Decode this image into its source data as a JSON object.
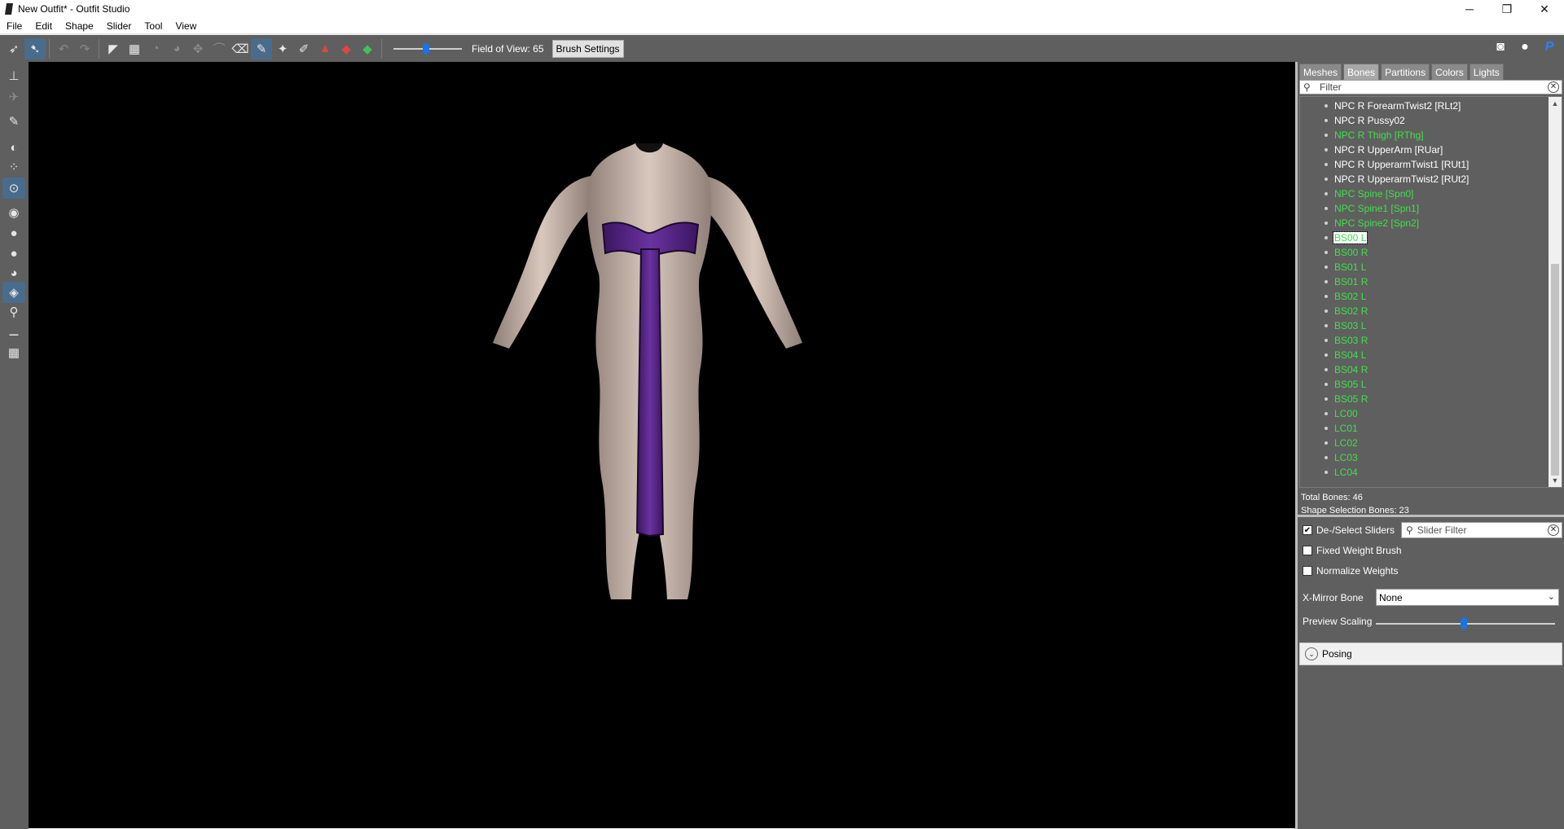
{
  "window": {
    "title": "New Outfit* - Outfit Studio"
  },
  "window_controls": {
    "minimize": "─",
    "maximize": "❐",
    "close": "✕"
  },
  "menu": [
    "File",
    "Edit",
    "Shape",
    "Slider",
    "Tool",
    "View"
  ],
  "toolbar": {
    "field_of_view_label": "Field of View: 65",
    "field_of_view_value": 65,
    "brush_settings_label": "Brush Settings",
    "right_icons": [
      "discord-icon",
      "github-icon",
      "paypal-icon"
    ]
  },
  "right_panel": {
    "tabs": [
      "Meshes",
      "Bones",
      "Partitions",
      "Colors",
      "Lights"
    ],
    "selected_tab": "Bones",
    "filter_placeholder": "Filter",
    "bones": [
      {
        "name": "NPC R ForearmTwist2 [RLt2]",
        "color": "white"
      },
      {
        "name": "NPC R Pussy02",
        "color": "white"
      },
      {
        "name": "NPC R Thigh [RThg]",
        "color": "green"
      },
      {
        "name": "NPC R UpperArm [RUar]",
        "color": "white"
      },
      {
        "name": "NPC R UpperarmTwist1 [RUt1]",
        "color": "white"
      },
      {
        "name": "NPC R UpperarmTwist2 [RUt2]",
        "color": "white"
      },
      {
        "name": "NPC Spine [Spn0]",
        "color": "green"
      },
      {
        "name": "NPC Spine1 [Spn1]",
        "color": "green"
      },
      {
        "name": "NPC Spine2 [Spn2]",
        "color": "green"
      },
      {
        "name": "BS00 L",
        "color": "green",
        "selected": true
      },
      {
        "name": "BS00 R",
        "color": "green"
      },
      {
        "name": "BS01 L",
        "color": "green"
      },
      {
        "name": "BS01 R",
        "color": "green"
      },
      {
        "name": "BS02 L",
        "color": "green"
      },
      {
        "name": "BS02 R",
        "color": "green"
      },
      {
        "name": "BS03 L",
        "color": "green"
      },
      {
        "name": "BS03 R",
        "color": "green"
      },
      {
        "name": "BS04 L",
        "color": "green"
      },
      {
        "name": "BS04 R",
        "color": "green"
      },
      {
        "name": "BS05 L",
        "color": "green"
      },
      {
        "name": "BS05 R",
        "color": "green"
      },
      {
        "name": "LC00",
        "color": "green"
      },
      {
        "name": "LC01",
        "color": "green"
      },
      {
        "name": "LC02",
        "color": "green"
      },
      {
        "name": "LC03",
        "color": "green"
      },
      {
        "name": "LC04",
        "color": "green"
      }
    ],
    "total_bones": "Total Bones: 46",
    "shape_selection_bones": "Shape Selection Bones: 23",
    "deselect_sliders_label": "De-/Select Sliders",
    "deselect_sliders_checked": true,
    "slider_filter_placeholder": "Slider Filter",
    "fixed_weight_brush_label": "Fixed Weight Brush",
    "fixed_weight_brush_checked": false,
    "normalize_weights_label": "Normalize Weights",
    "normalize_weights_checked": false,
    "x_mirror_bone_label": "X-Mirror Bone",
    "x_mirror_bone_value": "None",
    "preview_scaling_label": "Preview Scaling",
    "preview_scaling_fraction": 0.49,
    "posing_label": "Posing"
  },
  "colors": {
    "bone_green": "#3fe04a",
    "panel_gray": "#5f5f5f",
    "accent_blue": "#1a73e8",
    "outfit_purple": "#5a2a8a"
  }
}
